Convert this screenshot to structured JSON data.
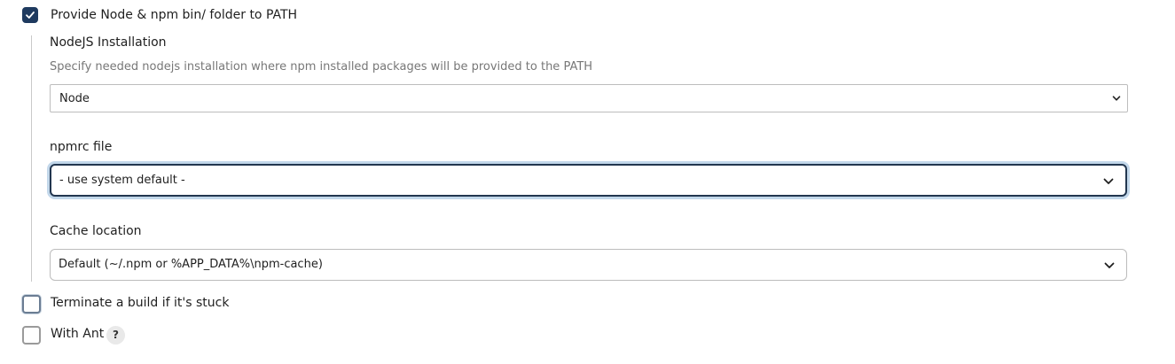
{
  "provide_node": {
    "label": "Provide Node & npm bin/ folder to PATH",
    "checked": true
  },
  "nodejs_installation": {
    "label": "NodeJS Installation",
    "description": "Specify needed nodejs installation where npm installed packages will be provided to the PATH",
    "selected": "Node"
  },
  "npmrc_file": {
    "label": "npmrc file",
    "selected": "- use system default -"
  },
  "cache_location": {
    "label": "Cache location",
    "selected": "Default (~/.npm or %APP_DATA%\\npm-cache)"
  },
  "terminate_build": {
    "label": "Terminate a build if it's stuck",
    "checked": false
  },
  "with_ant": {
    "label": "With Ant",
    "checked": false,
    "help": "?"
  },
  "colors": {
    "accent": "#1e3a5f",
    "focus_ring": "#c2d7ea",
    "muted_text": "#777777"
  }
}
